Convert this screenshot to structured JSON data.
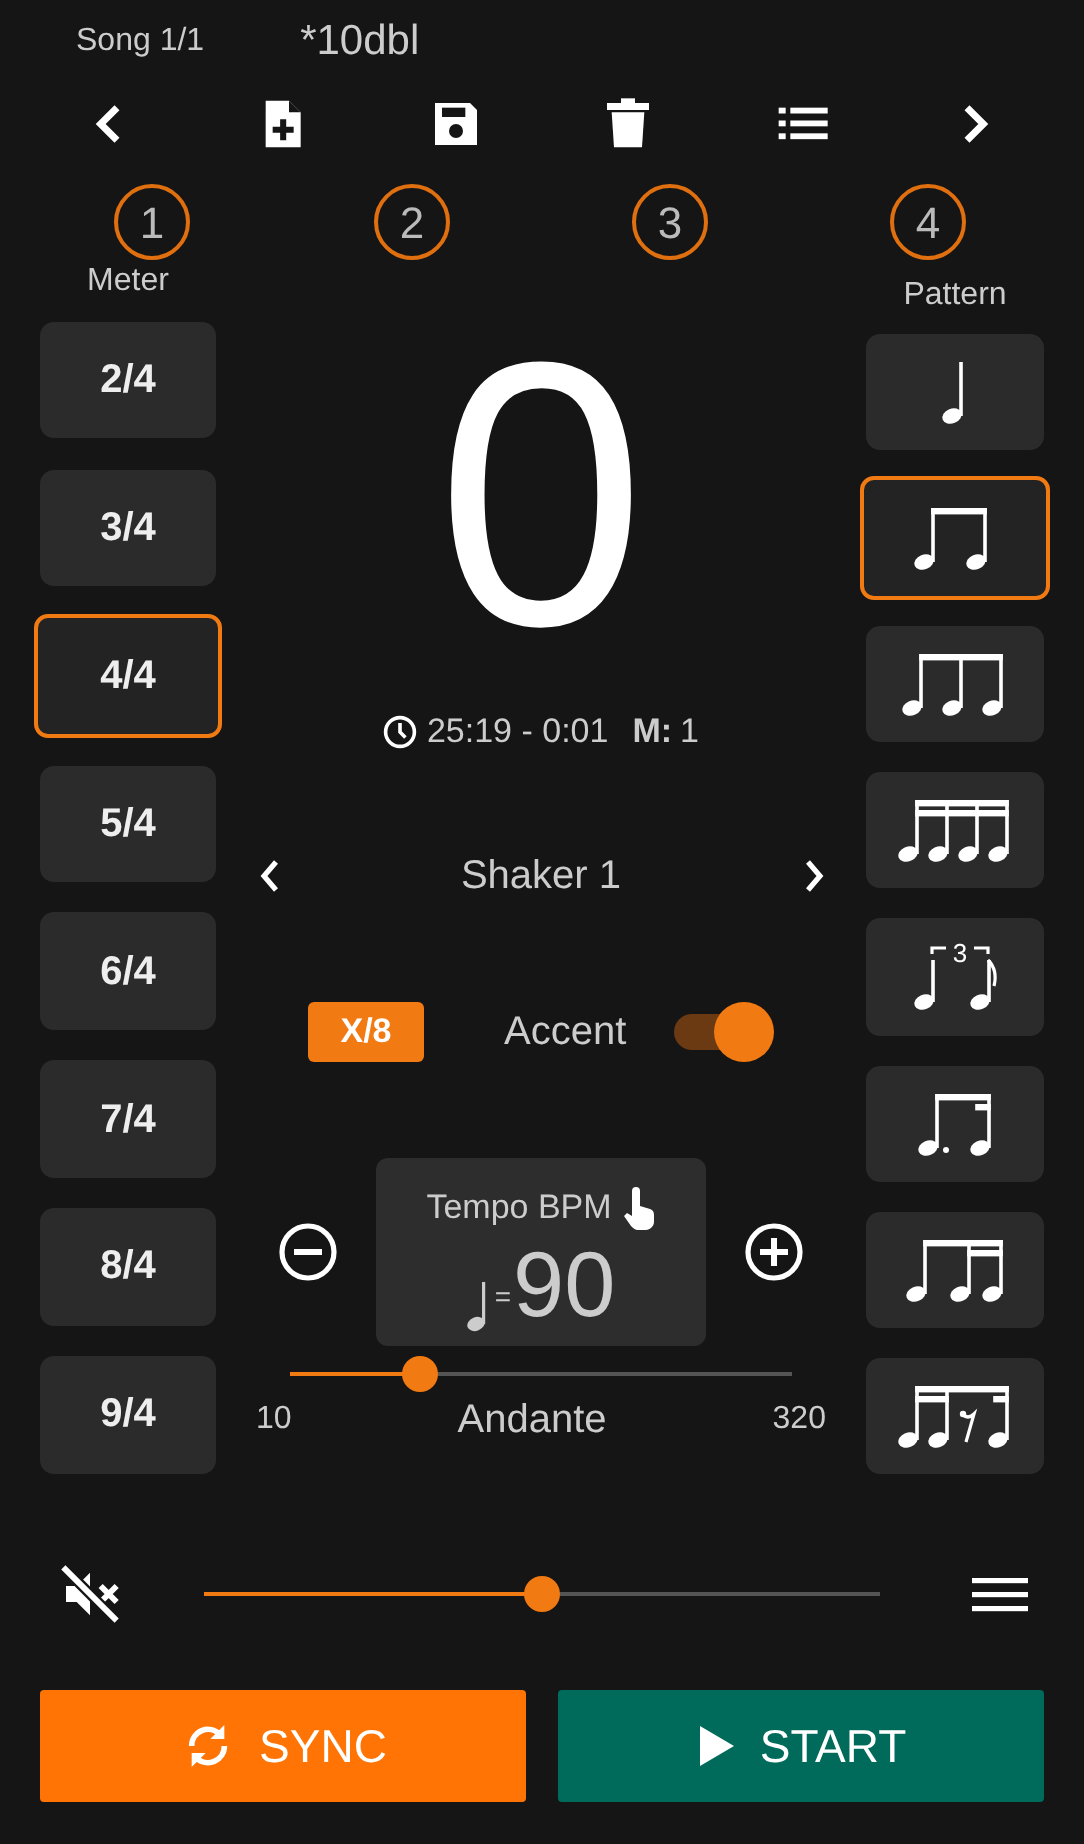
{
  "header": {
    "song": "Song 1/1",
    "title": "*10dbl"
  },
  "steps": [
    {
      "label": "1"
    },
    {
      "label": "2"
    },
    {
      "label": "3"
    },
    {
      "label": "4"
    }
  ],
  "meter": {
    "label": "Meter",
    "options": [
      {
        "label": "2/4",
        "selected": false
      },
      {
        "label": "3/4",
        "selected": false
      },
      {
        "label": "4/4",
        "selected": true
      },
      {
        "label": "5/4",
        "selected": false
      },
      {
        "label": "6/4",
        "selected": false
      },
      {
        "label": "7/4",
        "selected": false
      },
      {
        "label": "8/4",
        "selected": false
      },
      {
        "label": "9/4",
        "selected": false
      }
    ]
  },
  "pattern": {
    "label": "Pattern",
    "options": [
      {
        "kind": "quarter",
        "selected": false
      },
      {
        "kind": "eighths",
        "selected": true
      },
      {
        "kind": "triplet",
        "selected": false
      },
      {
        "kind": "sixteenths",
        "selected": false
      },
      {
        "kind": "tuplet",
        "tuplet": "3",
        "selected": false
      },
      {
        "kind": "dotted",
        "selected": false
      },
      {
        "kind": "eighth-sixteenths",
        "selected": false
      },
      {
        "kind": "sixteenth-rest",
        "selected": false
      }
    ]
  },
  "counter": "0",
  "time": {
    "text": "25:19 - 0:01",
    "measure_label": "M:",
    "measure": "1"
  },
  "sound": {
    "name": "Shaker 1"
  },
  "subdivision": "X/8",
  "accent": {
    "label": "Accent",
    "on": true
  },
  "tempo": {
    "label": "Tempo BPM",
    "equals": "=",
    "value": "90",
    "level": 0.26,
    "min": "10",
    "max": "320",
    "marking": "Andante"
  },
  "volume": {
    "muted": true,
    "level": 0.5
  },
  "actions": [
    {
      "kind": "sync",
      "label": "SYNC"
    },
    {
      "kind": "start",
      "label": "START"
    }
  ]
}
